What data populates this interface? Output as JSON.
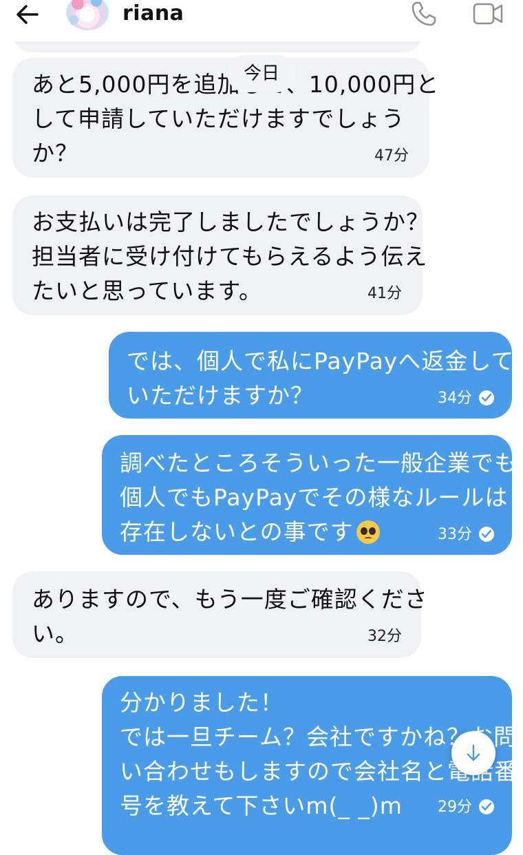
{
  "header": {
    "contact_name": "riana",
    "icons": [
      "back-arrow-icon",
      "avatar",
      "phone-icon",
      "video-call-icon"
    ]
  },
  "date_chip": "今日",
  "messages": [
    {
      "side": "left",
      "lines": [
        "あと5,000円を追加して、10,000円と",
        "して申請していただけますでしょう",
        "か？"
      ],
      "time": "47分"
    },
    {
      "side": "left",
      "lines": [
        "お支払いは完了しましたでしょうか？",
        "担当者に受け付けてもらえるよう伝え",
        "たいと思っています。"
      ],
      "time": "41分"
    },
    {
      "side": "right",
      "lines": [
        "では、個人で私にPayPayへ返金して",
        "いただけますか？"
      ],
      "time": "34分",
      "read": true
    },
    {
      "side": "right",
      "lines": [
        "調べたところそういった一般企業でも",
        "個人でもPayPayでその様なルールは",
        "存在しないとの事です"
      ],
      "time": "33分",
      "read": true,
      "emoji": "pleading-face-icon"
    },
    {
      "side": "left",
      "lines": [
        "ありますので、もう一度ご確認くださ",
        "い。"
      ],
      "time": "32分"
    },
    {
      "side": "right",
      "lines": [
        "分かりました！",
        "では一旦チーム？会社ですかね？お問",
        "い合わせもしますので会社名と電話番",
        "号を教えて下さいm(_ _)m"
      ],
      "time": "29分",
      "read": true
    }
  ],
  "colors": {
    "outgoing_bubble": "#4a9be8",
    "incoming_bubble": "#eff1f5"
  }
}
